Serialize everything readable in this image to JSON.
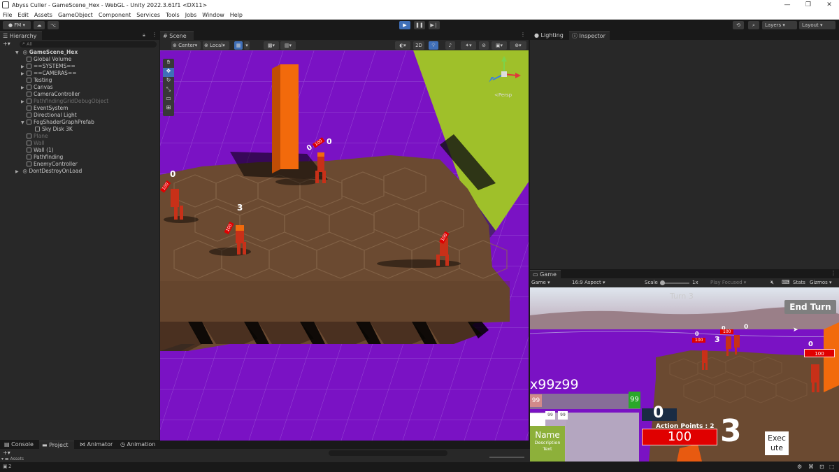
{
  "window": {
    "title": "Abyss Culler - GameScene_Hex - WebGL - Unity 2022.3.61f1 <DX11>",
    "controls": [
      "—",
      "❐",
      "✕"
    ]
  },
  "menu": [
    "File",
    "Edit",
    "Assets",
    "GameObject",
    "Component",
    "Services",
    "Tools",
    "Jobs",
    "Window",
    "Help"
  ],
  "toolbar": {
    "account": "FM",
    "layers_label": "Layers",
    "layout_label": "Layout"
  },
  "hierarchy": {
    "tab_label": "Hierarchy",
    "search_placeholder": "All",
    "scene_name": "GameScene_Hex",
    "items": [
      {
        "label": "Global Volume",
        "dim": false,
        "arrow": ""
      },
      {
        "label": "==SYSTEMS==",
        "dim": false,
        "arrow": "▶"
      },
      {
        "label": "==CAMERAS==",
        "dim": false,
        "arrow": "▶"
      },
      {
        "label": "Testing",
        "dim": false,
        "arrow": ""
      },
      {
        "label": "Canvas",
        "dim": false,
        "arrow": "▶"
      },
      {
        "label": "CameraController",
        "dim": false,
        "arrow": ""
      },
      {
        "label": "PathfindingGridDebugObject",
        "dim": true,
        "arrow": "▶"
      },
      {
        "label": "EventSystem",
        "dim": false,
        "arrow": ""
      },
      {
        "label": "Directional Light",
        "dim": false,
        "arrow": ""
      },
      {
        "label": "FogShaderGraphPrefab",
        "dim": false,
        "arrow": "▼"
      },
      {
        "label": "Sky Disk 3K",
        "dim": false,
        "arrow": "",
        "indent": true
      },
      {
        "label": "Plane",
        "dim": true,
        "arrow": ""
      },
      {
        "label": "Wall",
        "dim": true,
        "arrow": ""
      },
      {
        "label": "Wall (1)",
        "dim": false,
        "arrow": ""
      },
      {
        "label": "Pathfinding",
        "dim": false,
        "arrow": ""
      },
      {
        "label": "EnemyController",
        "dim": false,
        "arrow": ""
      }
    ],
    "dont_destroy": "DontDestroyOnLoad"
  },
  "scene": {
    "tab_label": "Scene",
    "pivot": "Center",
    "space": "Local",
    "mode_2d": "2D",
    "persp_label": "<Persp",
    "unit_labels": [
      {
        "hp": "0",
        "bar": "100"
      },
      {
        "hp": "0",
        "bar": "100"
      },
      {
        "hp": "3",
        "bar": "100"
      },
      {
        "hp": "0",
        "bar": "100"
      }
    ]
  },
  "right_tabs": {
    "lighting": "Lighting",
    "inspector": "Inspector"
  },
  "game": {
    "tab_label": "Game",
    "display": "Game",
    "aspect": "16:9 Aspect",
    "scale_label": "Scale",
    "scale_value": "1x",
    "play_focused": "Play Focused",
    "stats": "Stats",
    "gizmos": "Gizmos",
    "turn_text": "Turn 3",
    "end_turn": "End Turn",
    "coords": "x99z99",
    "stat_left": "99",
    "stat_right": "99",
    "small_a": "99",
    "small_b": "99",
    "counter": "0",
    "action_points": "Action Points : 2",
    "health": "100",
    "big_number": "3",
    "execute": "Exec ute",
    "name": "Name",
    "description": "Description Text",
    "unit_labels": [
      {
        "hp": "0",
        "bar": "100"
      },
      {
        "hp": "0",
        "bar": "100"
      },
      {
        "hp": "0",
        "bar": "100"
      },
      {
        "hp": "3",
        "bar": "100"
      }
    ]
  },
  "bottom_tabs": [
    "Console",
    "Project",
    "Animator",
    "Animation"
  ],
  "bottom": {
    "assets": "Assets",
    "count": "2"
  },
  "colors": {
    "purple_floor": "#7a12c4",
    "hex_brown": "#6b4a31",
    "wall_orange": "#f26a0c",
    "lime_wall": "#9fc02a",
    "unit_red": "#c83018",
    "hud_red": "#e00000",
    "hud_green": "#2aa82a",
    "hud_navy": "#1a2c44"
  }
}
